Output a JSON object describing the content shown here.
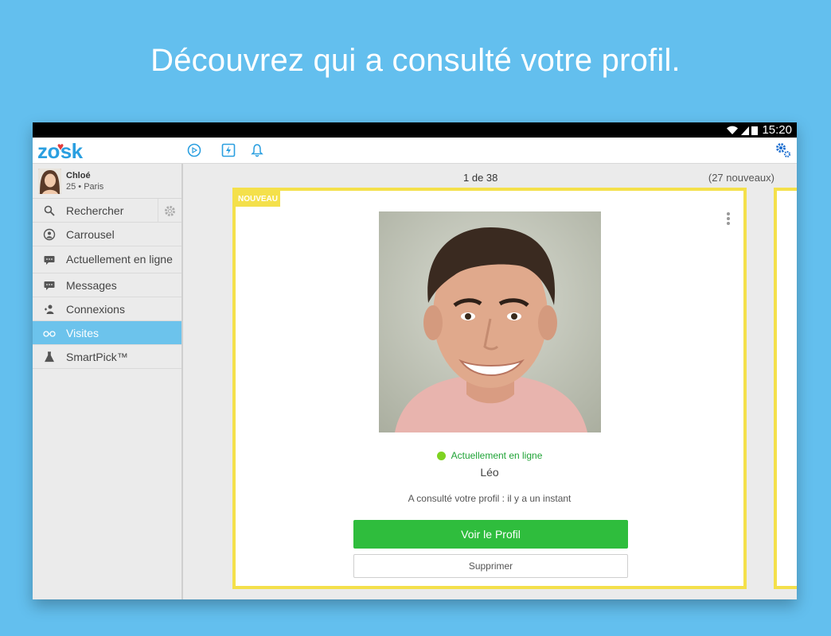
{
  "headline": "Découvrez qui a consulté votre profil.",
  "status_bar": {
    "time": "15:20"
  },
  "app": {
    "logo_text_left": "zo",
    "logo_text_right": "sk"
  },
  "user": {
    "name": "Chloé",
    "meta": "25 • Paris"
  },
  "sidebar": {
    "items": [
      {
        "label": "Rechercher",
        "icon": "search-icon"
      },
      {
        "label": "Carrousel",
        "icon": "carousel-icon"
      },
      {
        "label": "Actuellement en ligne",
        "icon": "chat-online-icon"
      },
      {
        "label": "Messages",
        "icon": "message-icon"
      },
      {
        "label": "Connexions",
        "icon": "connections-icon"
      },
      {
        "label": "Visites",
        "icon": "glasses-icon",
        "active": true
      },
      {
        "label": "SmartPick™",
        "icon": "flask-icon"
      }
    ]
  },
  "main": {
    "counter": "1 de 38",
    "new_count": "(27 nouveaux)",
    "card": {
      "badge": "NOUVEAU",
      "online_status": "Actuellement en ligne",
      "name": "Léo",
      "visited_text": "A consulté votre profil : il y a un instant",
      "view_button": "Voir le Profil",
      "delete_button": "Supprimer"
    }
  },
  "colors": {
    "background": "#63bfee",
    "accent_active": "#6cc3ec",
    "card_border": "#f4e04b",
    "primary_button": "#2fbd3d",
    "online_dot": "#7ed321",
    "brand_blue": "#2a9fe0"
  }
}
